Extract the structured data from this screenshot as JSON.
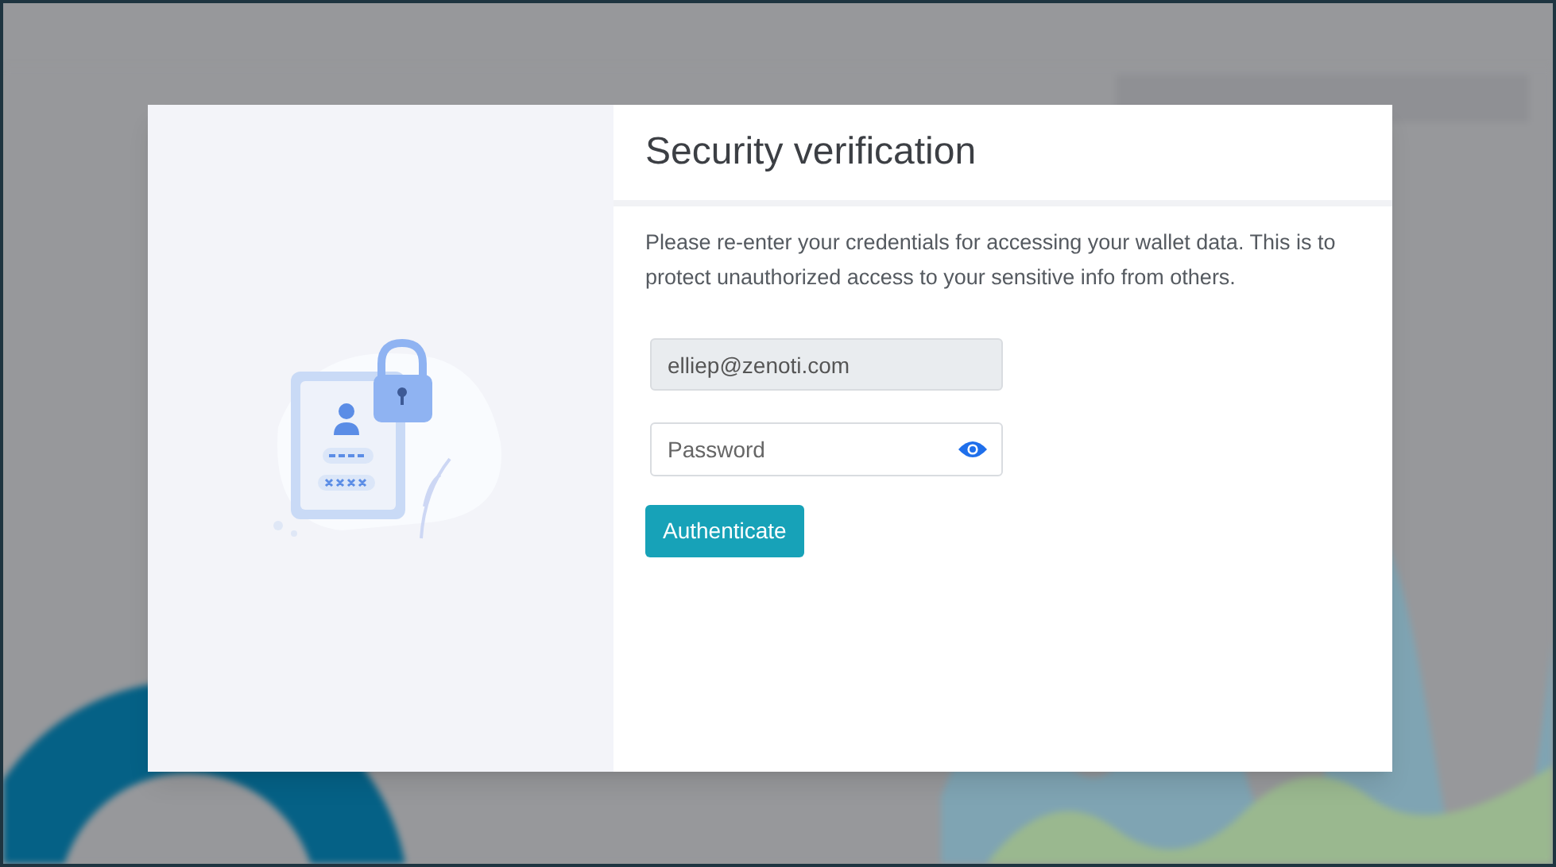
{
  "dialog": {
    "title": "Security verification",
    "message": "Please re-enter your credentials for accessing your wallet data. This is to protect unauthorized access to your sensitive info from others.",
    "email_field": {
      "value": "elliep@zenoti.com",
      "disabled": true
    },
    "password_field": {
      "placeholder": "Password"
    },
    "button": "Authenticate"
  }
}
